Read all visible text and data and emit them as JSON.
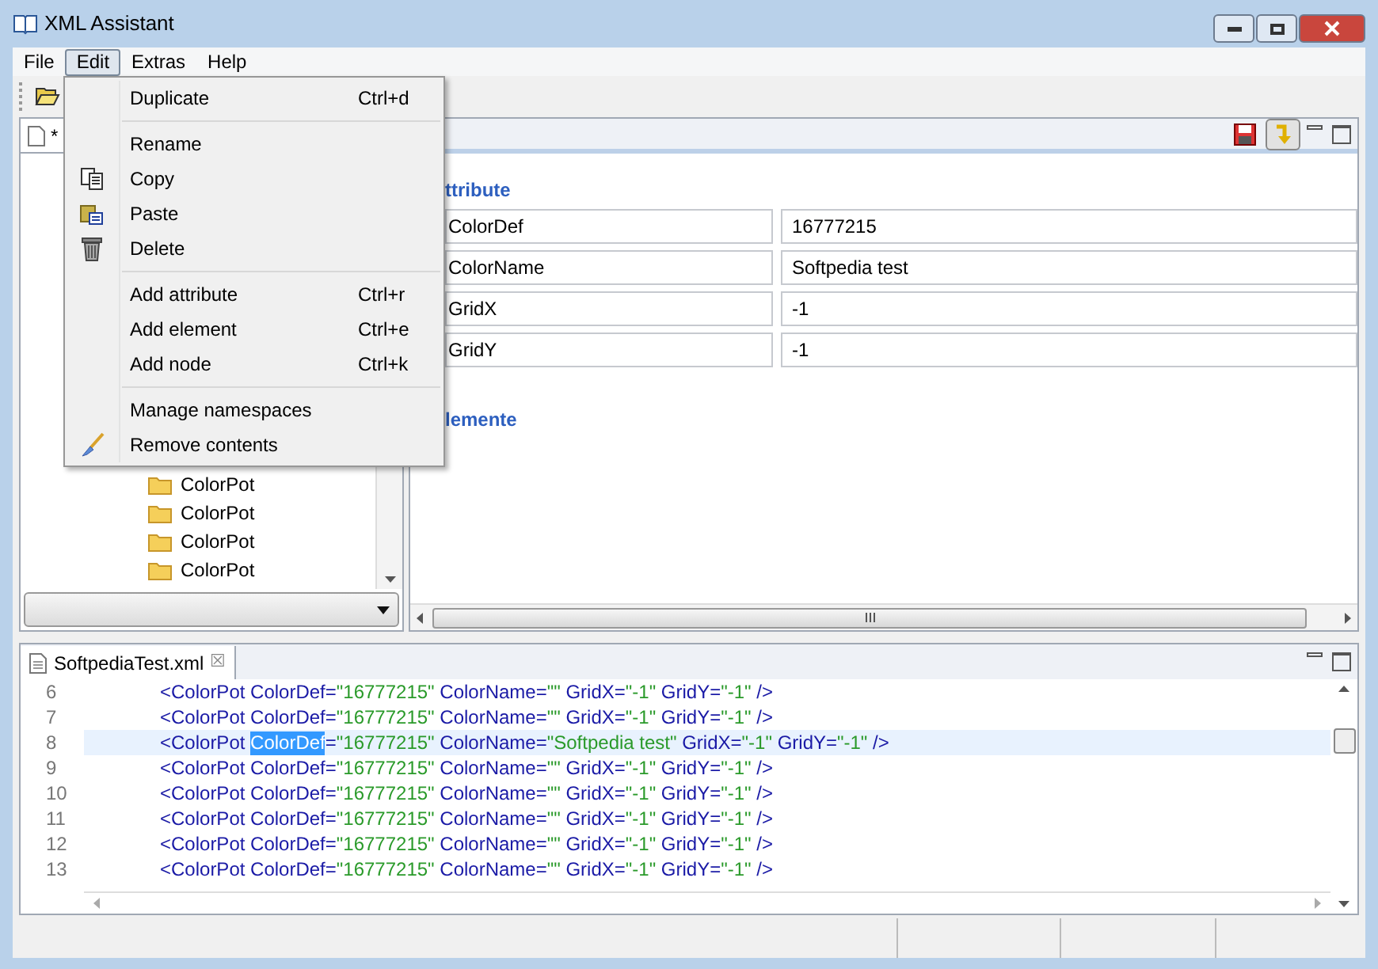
{
  "window": {
    "title": "XML Assistant"
  },
  "menubar": [
    {
      "label": "File",
      "selected": false
    },
    {
      "label": "Edit",
      "selected": true
    },
    {
      "label": "Extras",
      "selected": false
    },
    {
      "label": "Help",
      "selected": false
    }
  ],
  "edit_menu": [
    {
      "kind": "item",
      "label": "Duplicate",
      "shortcut": "Ctrl+d"
    },
    {
      "kind": "separator"
    },
    {
      "kind": "item",
      "label": "Rename"
    },
    {
      "kind": "copy",
      "label": "Copy"
    },
    {
      "kind": "paste",
      "label": "Paste"
    },
    {
      "kind": "trash",
      "label": "Delete"
    },
    {
      "kind": "separator"
    },
    {
      "kind": "item",
      "label": "Add attribute",
      "shortcut": "Ctrl+r"
    },
    {
      "kind": "item",
      "label": "Add element",
      "shortcut": "Ctrl+e"
    },
    {
      "kind": "item",
      "label": "Add node",
      "shortcut": "Ctrl+k"
    },
    {
      "kind": "separator"
    },
    {
      "kind": "item",
      "label": "Manage namespaces"
    },
    {
      "kind": "brush",
      "label": "Remove contents"
    }
  ],
  "tree_panel": {
    "tab": "*",
    "items": [
      "ColorPot",
      "ColorPot",
      "ColorPot",
      "ColorPot"
    ]
  },
  "detail_panel": {
    "toggle_pressed": true,
    "attributes_heading": "ttribute",
    "attributes": [
      {
        "name": "ColorDef",
        "value": "16777215"
      },
      {
        "name": "ColorName",
        "value": "Softpedia test"
      },
      {
        "name": "GridX",
        "value": "-1"
      },
      {
        "name": "GridY",
        "value": "-1"
      }
    ],
    "elements_heading": "lemente"
  },
  "editor": {
    "tab": "SoftpediaTest.xml",
    "close": "☒",
    "lines": [
      {
        "number": "6",
        "selected": false,
        "segments": [
          {
            "kind": "markup",
            "text": "<ColorPot ColorDef="
          },
          {
            "kind": "string",
            "text": "\"16777215\""
          },
          {
            "kind": "markup",
            "text": " ColorName="
          },
          {
            "kind": "string",
            "text": "\"\""
          },
          {
            "kind": "markup",
            "text": " GridX="
          },
          {
            "kind": "string",
            "text": "\"-1\""
          },
          {
            "kind": "markup",
            "text": " GridY="
          },
          {
            "kind": "string",
            "text": "\"-1\""
          },
          {
            "kind": "markup",
            "text": " />"
          }
        ]
      },
      {
        "number": "7",
        "selected": false,
        "segments": [
          {
            "kind": "markup",
            "text": "<ColorPot ColorDef="
          },
          {
            "kind": "string",
            "text": "\"16777215\""
          },
          {
            "kind": "markup",
            "text": " ColorName="
          },
          {
            "kind": "string",
            "text": "\"\""
          },
          {
            "kind": "markup",
            "text": " GridX="
          },
          {
            "kind": "string",
            "text": "\"-1\""
          },
          {
            "kind": "markup",
            "text": " GridY="
          },
          {
            "kind": "string",
            "text": "\"-1\""
          },
          {
            "kind": "markup",
            "text": " />"
          }
        ]
      },
      {
        "number": "8",
        "selected": true,
        "segments": [
          {
            "kind": "markup",
            "text": "<ColorPot "
          },
          {
            "kind": "selection",
            "text": "ColorDef"
          },
          {
            "kind": "markup",
            "text": "="
          },
          {
            "kind": "string",
            "text": "\"16777215\""
          },
          {
            "kind": "markup",
            "text": " ColorName="
          },
          {
            "kind": "string",
            "text": "\"Softpedia test\""
          },
          {
            "kind": "markup",
            "text": " GridX="
          },
          {
            "kind": "string",
            "text": "\"-1\""
          },
          {
            "kind": "markup",
            "text": " GridY="
          },
          {
            "kind": "string",
            "text": "\"-1\""
          },
          {
            "kind": "markup",
            "text": " />"
          }
        ]
      },
      {
        "number": "9",
        "selected": false,
        "segments": [
          {
            "kind": "markup",
            "text": "<ColorPot ColorDef="
          },
          {
            "kind": "string",
            "text": "\"16777215\""
          },
          {
            "kind": "markup",
            "text": " ColorName="
          },
          {
            "kind": "string",
            "text": "\"\""
          },
          {
            "kind": "markup",
            "text": " GridX="
          },
          {
            "kind": "string",
            "text": "\"-1\""
          },
          {
            "kind": "markup",
            "text": " GridY="
          },
          {
            "kind": "string",
            "text": "\"-1\""
          },
          {
            "kind": "markup",
            "text": " />"
          }
        ]
      },
      {
        "number": "10",
        "selected": false,
        "segments": [
          {
            "kind": "markup",
            "text": "<ColorPot ColorDef="
          },
          {
            "kind": "string",
            "text": "\"16777215\""
          },
          {
            "kind": "markup",
            "text": " ColorName="
          },
          {
            "kind": "string",
            "text": "\"\""
          },
          {
            "kind": "markup",
            "text": " GridX="
          },
          {
            "kind": "string",
            "text": "\"-1\""
          },
          {
            "kind": "markup",
            "text": " GridY="
          },
          {
            "kind": "string",
            "text": "\"-1\""
          },
          {
            "kind": "markup",
            "text": " />"
          }
        ]
      },
      {
        "number": "11",
        "selected": false,
        "segments": [
          {
            "kind": "markup",
            "text": "<ColorPot ColorDef="
          },
          {
            "kind": "string",
            "text": "\"16777215\""
          },
          {
            "kind": "markup",
            "text": " ColorName="
          },
          {
            "kind": "string",
            "text": "\"\""
          },
          {
            "kind": "markup",
            "text": " GridX="
          },
          {
            "kind": "string",
            "text": "\"-1\""
          },
          {
            "kind": "markup",
            "text": " GridY="
          },
          {
            "kind": "string",
            "text": "\"-1\""
          },
          {
            "kind": "markup",
            "text": " />"
          }
        ]
      },
      {
        "number": "12",
        "selected": false,
        "segments": [
          {
            "kind": "markup",
            "text": "<ColorPot ColorDef="
          },
          {
            "kind": "string",
            "text": "\"16777215\""
          },
          {
            "kind": "markup",
            "text": " ColorName="
          },
          {
            "kind": "string",
            "text": "\"\""
          },
          {
            "kind": "markup",
            "text": " GridX="
          },
          {
            "kind": "string",
            "text": "\"-1\""
          },
          {
            "kind": "markup",
            "text": " GridY="
          },
          {
            "kind": "string",
            "text": "\"-1\""
          },
          {
            "kind": "markup",
            "text": " />"
          }
        ]
      },
      {
        "number": "13",
        "selected": false,
        "segments": [
          {
            "kind": "markup",
            "text": "<ColorPot ColorDef="
          },
          {
            "kind": "string",
            "text": "\"16777215\""
          },
          {
            "kind": "markup",
            "text": " ColorName="
          },
          {
            "kind": "string",
            "text": "\"\""
          },
          {
            "kind": "markup",
            "text": " GridX="
          },
          {
            "kind": "string",
            "text": "\"-1\""
          },
          {
            "kind": "markup",
            "text": " GridY="
          },
          {
            "kind": "string",
            "text": "\"-1\""
          },
          {
            "kind": "markup",
            "text": " />"
          }
        ]
      }
    ]
  }
}
